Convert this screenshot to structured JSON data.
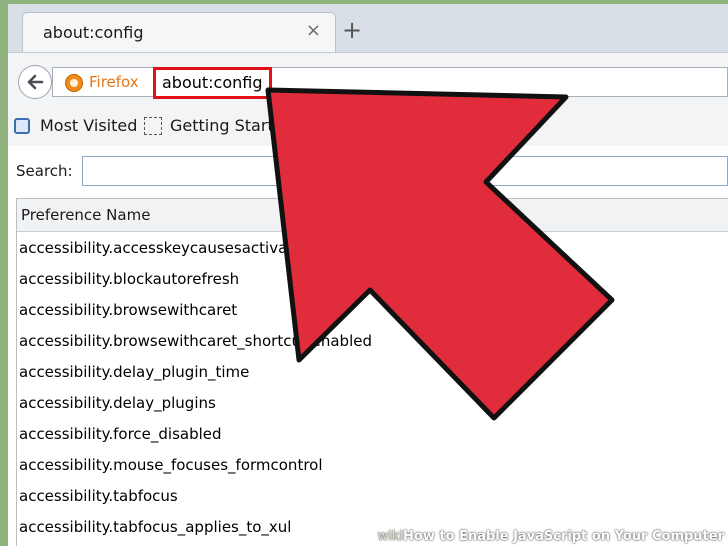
{
  "tab": {
    "title": "about:config",
    "close_glyph": "×",
    "new_tab_glyph": "+"
  },
  "navbar": {
    "identity_label": "Firefox",
    "url": "about:config"
  },
  "bookmarks": [
    {
      "label": "Most Visited",
      "icon": "bookmarks-folder-icon"
    },
    {
      "label": "Getting Started",
      "icon": "page-placeholder-icon"
    }
  ],
  "search": {
    "label": "Search:",
    "value": ""
  },
  "table": {
    "column_header": "Preference Name",
    "rows": [
      "accessibility.accesskeycausesactivation",
      "accessibility.blockautorefresh",
      "accessibility.browsewithcaret",
      "accessibility.browsewithcaret_shortcut.enabled",
      "accessibility.delay_plugin_time",
      "accessibility.delay_plugins",
      "accessibility.force_disabled",
      "accessibility.mouse_focuses_formcontrol",
      "accessibility.tabfocus",
      "accessibility.tabfocus_applies_to_xul"
    ]
  },
  "annotation": {
    "arrow_color": "#e12c3c",
    "highlight_color": "#e3101a"
  },
  "watermark": {
    "logo": "wiki",
    "text": "How to Enable JavaScript on Your Computer"
  }
}
